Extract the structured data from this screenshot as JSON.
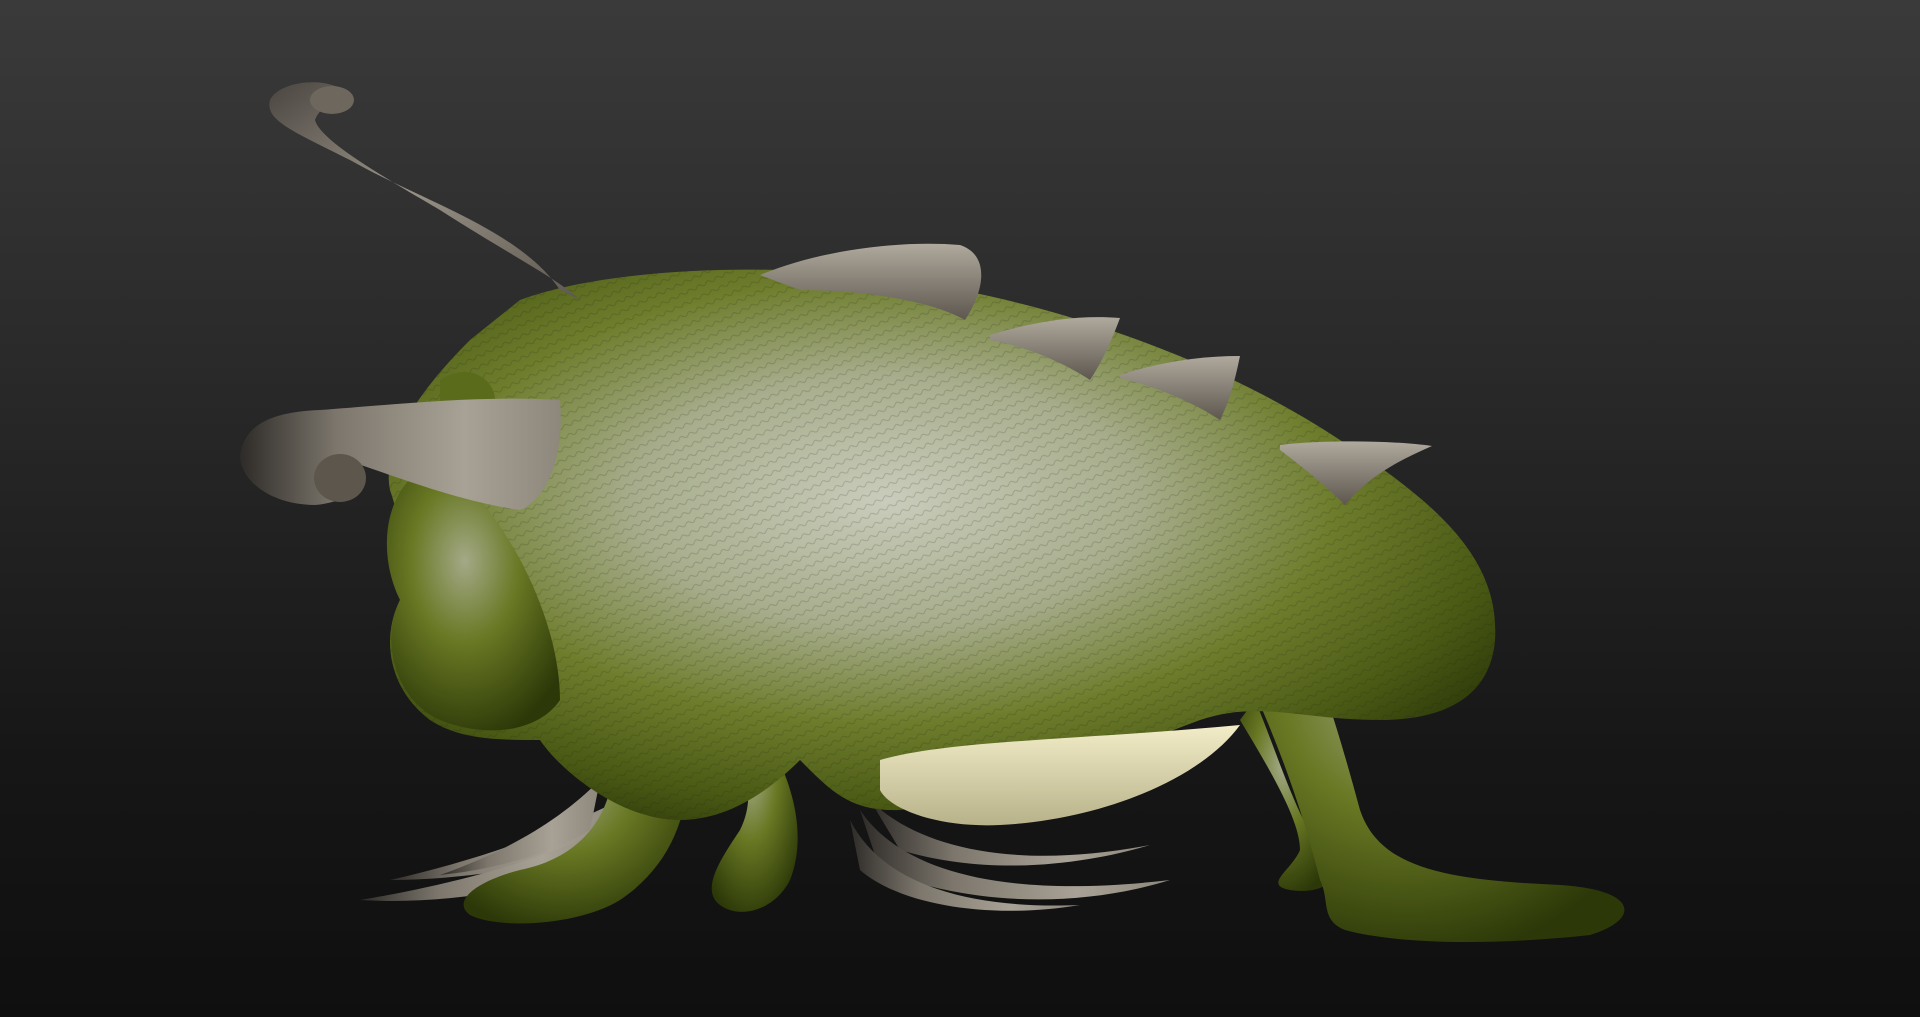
{
  "viewport": {
    "background_top": "#3a3a3a",
    "background_bottom": "#0f0f0f"
  },
  "model": {
    "skin_color": "#5b6b1c",
    "skin_highlight": "#c8cbb8",
    "horn_color": "#8a8378",
    "belly_color": "#e8e4b8"
  }
}
